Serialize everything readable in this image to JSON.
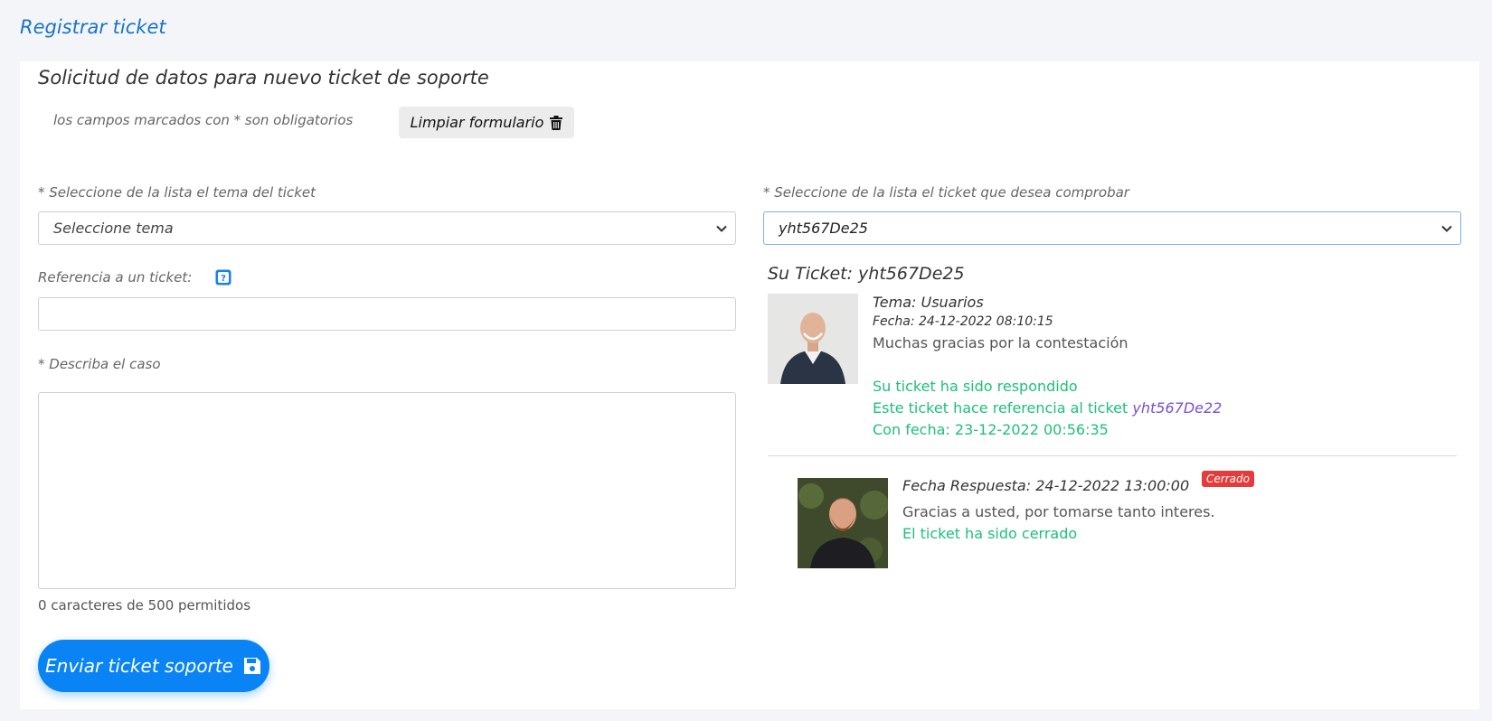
{
  "page": {
    "title": "Registrar ticket"
  },
  "form": {
    "heading": "Solicitud de datos para nuevo ticket de soporte",
    "required_note": "los campos marcados con * son obligatorios",
    "clear_label": "Limpiar formulario",
    "topic_label": "* Seleccione de la lista el tema del ticket",
    "topic_value": "Seleccione tema",
    "reference_label": "Referencia a un ticket:",
    "reference_value": "",
    "describe_label": "* Describa el caso",
    "describe_value": "",
    "char_counter": "0 caracteres de 500 permitidos",
    "send_label": "Enviar ticket soporte"
  },
  "check": {
    "label": "* Seleccione de la lista el ticket que desea comprobar",
    "selected": "yht567De25"
  },
  "ticket": {
    "title": "Su Ticket: yht567De25",
    "topic": "Tema: Usuarios",
    "date": "Fecha: 24-12-2022 08:10:15",
    "message": "Muchas gracias por la contestación",
    "status": "Su ticket ha sido respondido",
    "ref_text": "Este ticket hace referencia al ticket",
    "ref_id": "yht567De22",
    "ref_date": "Con fecha: 23-12-2022 00:56:35"
  },
  "response": {
    "date": "Fecha Respuesta: 24-12-2022 13:00:00",
    "badge": "Cerrado",
    "message": "Gracias a usted, por tomarse tanto interes.",
    "status": "El ticket ha sido cerrado"
  },
  "colors": {
    "accent": "#0a84f5",
    "success": "#1ec07a",
    "danger": "#e63b3b",
    "link": "#7a4fd0"
  },
  "icons": {
    "clear": "trash-icon",
    "send": "save-icon",
    "help": "question-icon",
    "select": "chevron-down-icon"
  }
}
